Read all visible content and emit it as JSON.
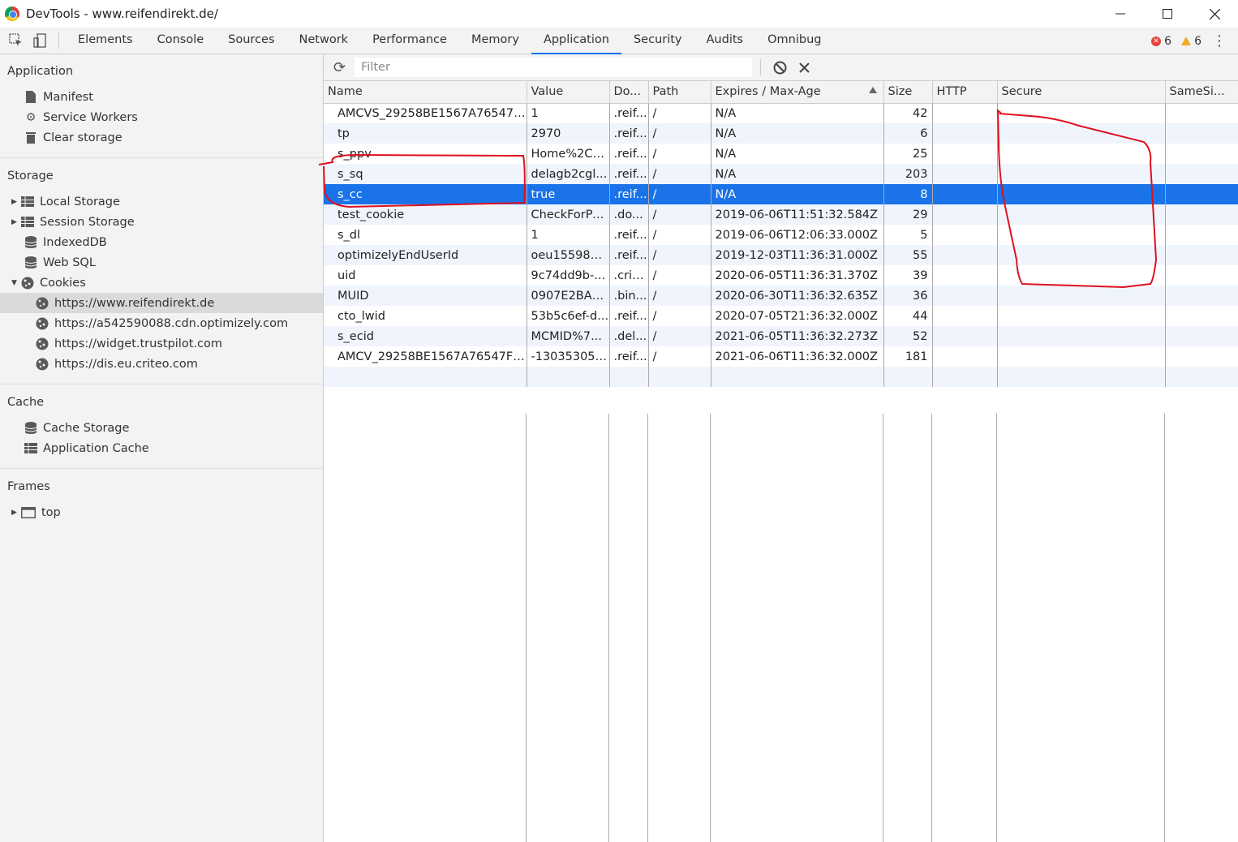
{
  "window": {
    "title": "DevTools - www.reifendirekt.de/"
  },
  "tabs": [
    "Elements",
    "Console",
    "Sources",
    "Network",
    "Performance",
    "Memory",
    "Application",
    "Security",
    "Audits",
    "Omnibug"
  ],
  "active_tab": "Application",
  "counters": {
    "errors": "6",
    "warnings": "6"
  },
  "sidebar": {
    "application_title": "Application",
    "application_items": [
      "Manifest",
      "Service Workers",
      "Clear storage"
    ],
    "storage_title": "Storage",
    "storage_items": [
      "Local Storage",
      "Session Storage",
      "IndexedDB",
      "Web SQL",
      "Cookies"
    ],
    "cookie_origins": [
      "https://www.reifendirekt.de",
      "https://a542590088.cdn.optimizely.com",
      "https://widget.trustpilot.com",
      "https://dis.eu.criteo.com"
    ],
    "cache_title": "Cache",
    "cache_items": [
      "Cache Storage",
      "Application Cache"
    ],
    "frames_title": "Frames",
    "frames_items": [
      "top"
    ]
  },
  "filter": {
    "placeholder": "Filter"
  },
  "columns": [
    "Name",
    "Value",
    "Do...",
    "Path",
    "Expires / Max-Age",
    "Size",
    "HTTP",
    "Secure",
    "SameSi..."
  ],
  "rows": [
    {
      "name": "AMCVS_29258BE1567A76547F0...",
      "value": "1",
      "domain": ".reif...",
      "path": "/",
      "expires": "N/A",
      "size": "42"
    },
    {
      "name": "tp",
      "value": "2970",
      "domain": ".reif...",
      "path": "/",
      "expires": "N/A",
      "size": "6"
    },
    {
      "name": "s_ppv",
      "value": "Home%2C2...",
      "domain": ".reif...",
      "path": "/",
      "expires": "N/A",
      "size": "25"
    },
    {
      "name": "s_sq",
      "value": "delagb2cgl...",
      "domain": ".reif...",
      "path": "/",
      "expires": "N/A",
      "size": "203"
    },
    {
      "name": "s_cc",
      "value": "true",
      "domain": ".reif...",
      "path": "/",
      "expires": "N/A",
      "size": "8"
    },
    {
      "name": "test_cookie",
      "value": "CheckForPe...",
      "domain": ".do...",
      "path": "/",
      "expires": "2019-06-06T11:51:32.584Z",
      "size": "29"
    },
    {
      "name": "s_dl",
      "value": "1",
      "domain": ".reif...",
      "path": "/",
      "expires": "2019-06-06T12:06:33.000Z",
      "size": "5"
    },
    {
      "name": "optimizelyEndUserId",
      "value": "oeu155982...",
      "domain": ".reif...",
      "path": "/",
      "expires": "2019-12-03T11:36:31.000Z",
      "size": "55"
    },
    {
      "name": "uid",
      "value": "9c74dd9b-...",
      "domain": ".crit...",
      "path": "/",
      "expires": "2020-06-05T11:36:31.370Z",
      "size": "39"
    },
    {
      "name": "MUID",
      "value": "0907E2BAB...",
      "domain": ".bin...",
      "path": "/",
      "expires": "2020-06-30T11:36:32.635Z",
      "size": "36"
    },
    {
      "name": "cto_lwid",
      "value": "53b5c6ef-d...",
      "domain": ".reif...",
      "path": "/",
      "expires": "2020-07-05T21:36:32.000Z",
      "size": "44"
    },
    {
      "name": "s_ecid",
      "value": "MCMID%7...",
      "domain": ".del...",
      "path": "/",
      "expires": "2021-06-05T11:36:32.273Z",
      "size": "52"
    },
    {
      "name": "AMCV_29258BE1567A76547F00...",
      "value": "-130353058...",
      "domain": ".reif...",
      "path": "/",
      "expires": "2021-06-06T11:36:32.000Z",
      "size": "181"
    }
  ],
  "selected_row": 4,
  "colors": {
    "accent": "#1a73e8",
    "annotation": "#e0101e"
  }
}
